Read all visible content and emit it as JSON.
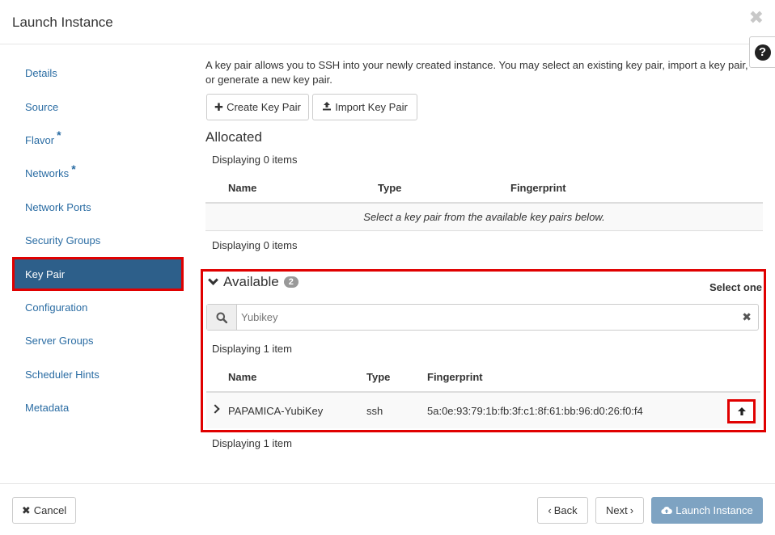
{
  "dialog": {
    "title": "Launch Instance",
    "close_icon": "close-icon",
    "help_glyph": "?"
  },
  "sidebar": {
    "items": [
      {
        "label": "Details",
        "required": false
      },
      {
        "label": "Source",
        "required": false
      },
      {
        "label": "Flavor",
        "required": true
      },
      {
        "label": "Networks",
        "required": true
      },
      {
        "label": "Network Ports",
        "required": false
      },
      {
        "label": "Security Groups",
        "required": false
      },
      {
        "label": "Key Pair",
        "required": false,
        "active": true
      },
      {
        "label": "Configuration",
        "required": false
      },
      {
        "label": "Server Groups",
        "required": false
      },
      {
        "label": "Scheduler Hints",
        "required": false
      },
      {
        "label": "Metadata",
        "required": false
      }
    ],
    "required_mark": "*"
  },
  "main": {
    "description": "A key pair allows you to SSH into your newly created instance. You may select an existing key pair, import a key pair, or generate a new key pair.",
    "create_button": "Create Key Pair",
    "import_button": "Import Key Pair",
    "allocated": {
      "title": "Allocated",
      "displaying_top": "Displaying 0 items",
      "columns": [
        "Name",
        "Type",
        "Fingerprint"
      ],
      "empty_message": "Select a key pair from the available key pairs below.",
      "displaying_bottom": "Displaying 0 items"
    },
    "available": {
      "title": "Available",
      "count": "2",
      "select_hint": "Select one",
      "search_value": "Yubikey",
      "search_clear": "✖",
      "displaying_top": "Displaying 1 item",
      "columns": [
        "Name",
        "Type",
        "Fingerprint"
      ],
      "rows": [
        {
          "name": "PAPAMICA-YubiKey",
          "type": "ssh",
          "fingerprint": "5a:0e:93:79:1b:fb:3f:c1:8f:61:bb:96:d0:26:f0:f4"
        }
      ],
      "displaying_bottom": "Displaying 1 item"
    }
  },
  "footer": {
    "cancel": "Cancel",
    "back": "Back",
    "next": "Next",
    "launch": "Launch Instance"
  },
  "colors": {
    "accent": "#2d5f8a",
    "link": "#2a6ca3",
    "highlight": "#e00000",
    "launch_button": "#7ea3c2"
  }
}
